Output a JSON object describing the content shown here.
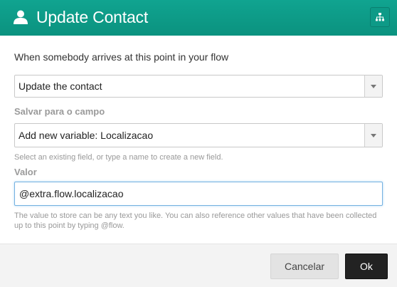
{
  "header": {
    "title": "Update Contact",
    "icon": "user-icon",
    "flow_button_icon": "sitemap-icon",
    "background": "#0e9c89"
  },
  "form": {
    "intro": "When somebody arrives at this point in your flow",
    "action_select": {
      "value": "Update the contact"
    },
    "field_label": "Salvar para o campo",
    "field_select": {
      "value": "Add new variable: Localizacao"
    },
    "field_help": "Select an existing field, or type a name to create a new field.",
    "value_label": "Valor",
    "value_input": {
      "value": "@extra.flow.localizacao"
    },
    "value_help": "The value to store can be any text you like. You can also reference other values that have been collected up to this point by typing @flow."
  },
  "footer": {
    "cancel_label": "Cancelar",
    "ok_label": "Ok"
  }
}
